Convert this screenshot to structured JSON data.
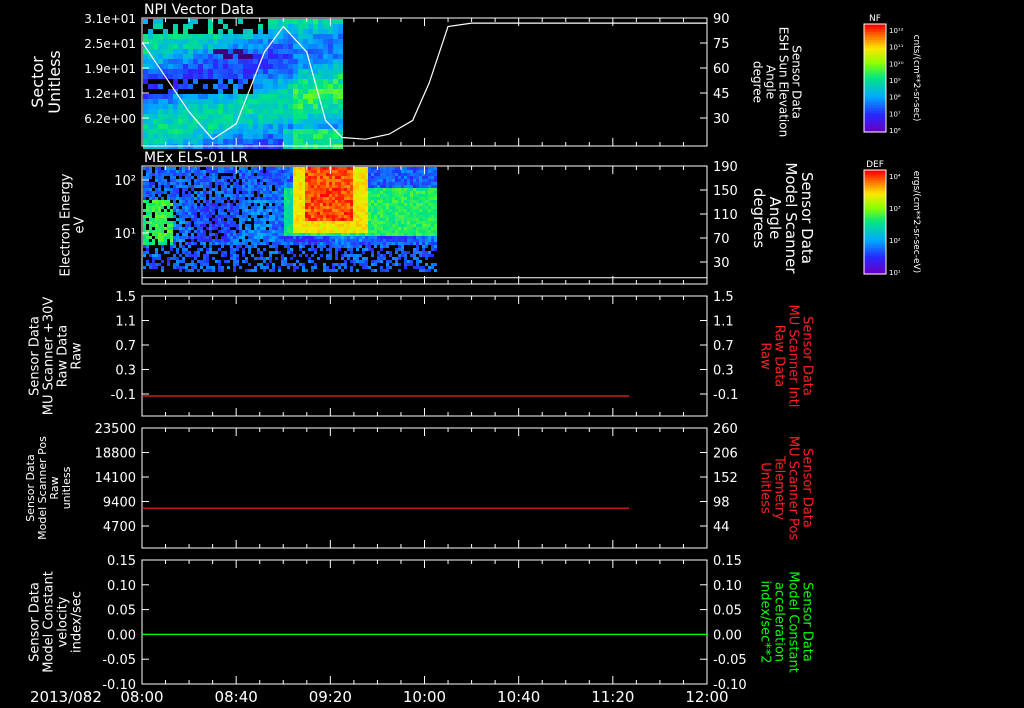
{
  "date": "2013/082",
  "time_ticks": [
    "08:00",
    "08:40",
    "09:20",
    "10:00",
    "10:40",
    "11:20",
    "12:00"
  ],
  "colors": {
    "background": "#000000",
    "axis": "#ffffff",
    "red": "#ff2020",
    "green": "#00ff00"
  },
  "chart_data": [
    {
      "type": "heatmap",
      "title": "NPI Vector Data",
      "ylabel": [
        "Sector",
        "Unitless"
      ],
      "yticks": [
        "3.1e+01",
        "2.5e+01",
        "1.9e+01",
        "1.2e+01",
        "6.2e+00"
      ],
      "y2label": [
        "Sensor Data",
        "ESH Sun Elevation",
        "Angle",
        "degree"
      ],
      "y2ticks": [
        "90",
        "75",
        "60",
        "45",
        "30"
      ],
      "y2lim": [
        15,
        90
      ],
      "line_series": {
        "name": "ESH Sun Elevation Angle",
        "x": [
          "08:00",
          "08:20",
          "08:30",
          "08:40",
          "08:52",
          "09:00",
          "09:10",
          "09:18",
          "09:25",
          "09:35",
          "09:45",
          "09:55",
          "10:02",
          "10:10",
          "10:20",
          "12:00"
        ],
        "y": [
          76,
          35,
          19,
          28,
          70,
          85,
          70,
          30,
          20,
          19,
          22,
          30,
          52,
          85,
          87,
          87
        ]
      },
      "colorbar": {
        "label": "NF",
        "unit": "cnts/(cm**2-sr-sec)",
        "ticks": [
          "10¹²",
          "10¹¹",
          "10¹⁰",
          "10⁹",
          "10⁸",
          "10⁷",
          "10⁶"
        ]
      }
    },
    {
      "type": "heatmap",
      "title": "MEx ELS-01 LR",
      "ylabel": [
        "Electron Energy",
        "eV"
      ],
      "yticks": [
        "10²",
        "10¹"
      ],
      "y2label": [
        "Sensor Data",
        "Model Scanner",
        "Angle",
        "degrees"
      ],
      "y2ticks": [
        "190",
        "150",
        "110",
        "70",
        "30"
      ],
      "y2lim": [
        0,
        190
      ],
      "line_series": {
        "name": "Model Scanner Angle",
        "x": [
          "08:00",
          "12:00"
        ],
        "y": [
          10,
          10
        ]
      },
      "colorbar": {
        "label": "DEF",
        "unit": "ergs/(cm**2-sr-sec-eV)",
        "ticks": [
          "10⁴",
          "10³",
          "10²",
          "10¹"
        ]
      }
    },
    {
      "type": "line",
      "ylabel": [
        "Sensor Data",
        "MU Scanner +30V",
        "Raw Data",
        "Raw"
      ],
      "yticks": [
        "1.5",
        "1.1",
        "0.7",
        "0.3",
        "-0.1"
      ],
      "ylim": [
        -0.3,
        1.5
      ],
      "y2label": [
        "Sensor Data",
        "MU Scanner Intl",
        "Raw Data",
        "Raw"
      ],
      "y2ticks": [
        "1.5",
        "1.1",
        "0.7",
        "0.3",
        "-0.1"
      ],
      "series": [
        {
          "x": [
            "08:00",
            "11:27"
          ],
          "y": [
            0.0,
            0.0
          ]
        }
      ]
    },
    {
      "type": "line",
      "ylabel": [
        "Sensor Data",
        "Model Scanner Pos",
        "Raw",
        "unitless"
      ],
      "yticks": [
        "23500",
        "18800",
        "14100",
        "9400",
        "4700"
      ],
      "ylim": [
        0,
        23500
      ],
      "y2label": [
        "Sensor Data",
        "MU Scanner Pos",
        "Telemetry",
        "Unitless"
      ],
      "y2ticks": [
        "260",
        "206",
        "152",
        "98",
        "44"
      ],
      "series": [
        {
          "x": [
            "08:00",
            "11:27"
          ],
          "y": [
            7800,
            7800
          ]
        }
      ]
    },
    {
      "type": "line",
      "ylabel": [
        "Sensor Data",
        "Model Constant",
        "velocity",
        "index/sec"
      ],
      "yticks": [
        "0.15",
        "0.10",
        "0.05",
        "0.00",
        "-0.05",
        "-0.10"
      ],
      "ylim": [
        -0.1,
        0.15
      ],
      "y2label": [
        "Sensor Data",
        "Model Constant",
        "acceleration",
        "index/sec**2"
      ],
      "y2ticks": [
        "0.15",
        "0.10",
        "0.05",
        "0.00",
        "-0.05",
        "-0.10"
      ],
      "series": [
        {
          "x": [
            "08:00",
            "12:00"
          ],
          "y": [
            0.0,
            0.0
          ]
        }
      ]
    }
  ]
}
